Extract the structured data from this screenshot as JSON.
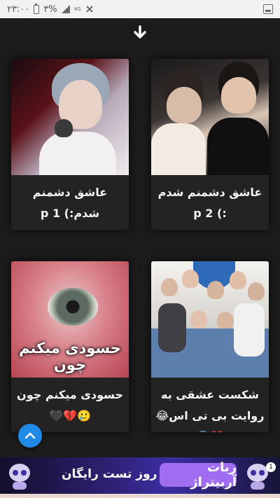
{
  "status_bar": {
    "time": "۲۳:۰۰",
    "battery": "۳%",
    "network": "4G"
  },
  "stories": [
    {
      "title": "عاشق دشمنم شدم :) p 2",
      "thumb": "two-boys-photo"
    },
    {
      "title": "عاشق دشمنم شدم:) p 1",
      "thumb": "boy-portrait-photo"
    },
    {
      "title": "شکست عشقی به روایت بی تی اس😂💔🌚",
      "thumb": "group-photo"
    },
    {
      "title": "حسودی میکنم چون🥲💔🖤",
      "thumb": "eye-photo",
      "overlay_text": "حسودی میکنم چون"
    }
  ],
  "ad": {
    "brand": "ربات آربیتراژ",
    "offer": "15 روز تست رایگان",
    "badge": "1"
  },
  "colors": {
    "background": "#1c1c1c",
    "card": "#232323",
    "fab": "#1f8be6",
    "ad_brand": "#a06cf0"
  },
  "icons": {
    "scroll_down": "arrow-down-icon",
    "scroll_up": "chevron-up-icon"
  }
}
